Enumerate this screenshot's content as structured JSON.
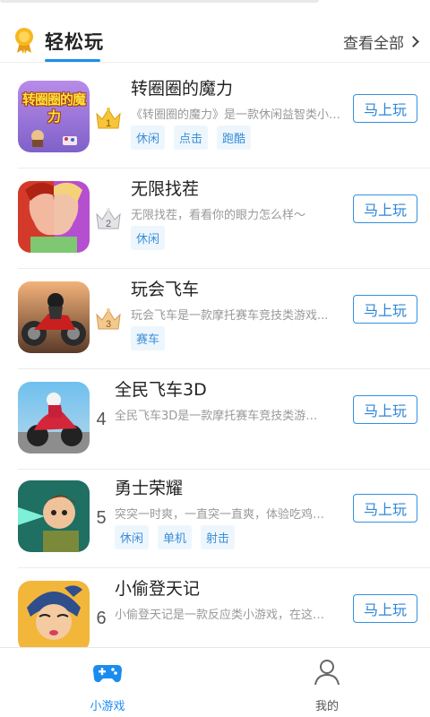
{
  "header": {
    "title": "轻松玩",
    "view_all": "查看全部"
  },
  "games": [
    {
      "rank": "1",
      "name": "转圈圈的魔力",
      "desc": "《转圈圈的魔力》是一款休闲益智类小游戏...",
      "tags": [
        "休闲",
        "点击",
        "跑酷"
      ],
      "play_label": "马上玩",
      "icon_text": "转圈圈的魔力"
    },
    {
      "rank": "2",
      "name": "无限找茬",
      "desc": "无限找茬，看看你的眼力怎么样～",
      "tags": [
        "休闲"
      ],
      "play_label": "马上玩"
    },
    {
      "rank": "3",
      "name": "玩会飞车",
      "desc": "玩会飞车是一款摩托赛车竞技类游戏...",
      "tags": [
        "赛车"
      ],
      "play_label": "马上玩"
    },
    {
      "rank": "4",
      "name": "全民飞车3D",
      "desc": "全民飞车3D是一款摩托赛车竞技类游戏...",
      "tags": [],
      "play_label": "马上玩"
    },
    {
      "rank": "5",
      "name": "勇士荣耀",
      "desc": "突突一时爽，一直突一直爽，体验吃鸡快感...",
      "tags": [
        "休闲",
        "单机",
        "射击"
      ],
      "play_label": "马上玩"
    },
    {
      "rank": "6",
      "name": "小偷登天记",
      "desc": "小偷登天记是一款反应类小游戏，在这里...",
      "tags": [],
      "play_label": "马上玩"
    }
  ],
  "tabbar": {
    "games_label": "小游戏",
    "mine_label": "我的"
  },
  "colors": {
    "accent": "#1a8cf0",
    "tag_bg": "#eef6fd",
    "gold": "#f2b01e"
  }
}
